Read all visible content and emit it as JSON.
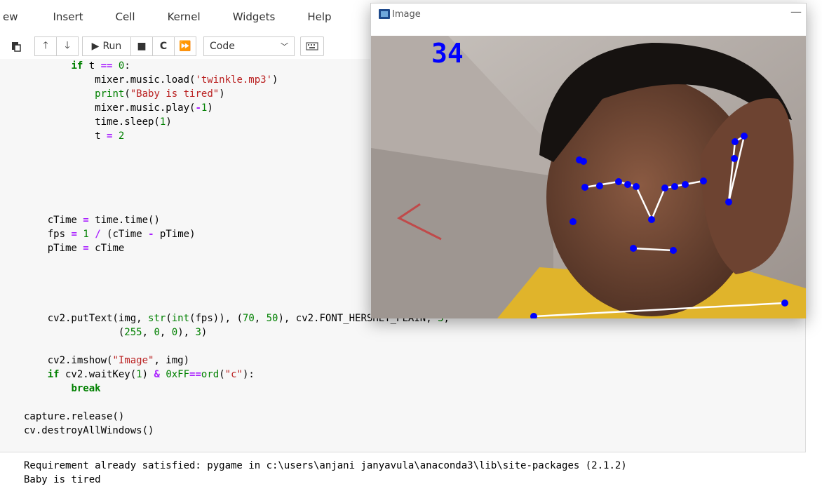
{
  "menu": [
    "ew",
    "Insert",
    "Cell",
    "Kernel",
    "Widgets",
    "Help"
  ],
  "toolbar": {
    "run_label": "Run",
    "cell_type": "Code"
  },
  "code_lines": [
    "        if t == 0:",
    "            mixer.music.load('twinkle.mp3')",
    "            print(\"Baby is tired\")",
    "            mixer.music.play(-1)",
    "            time.sleep(1)",
    "            t = 2",
    "",
    "",
    "",
    "",
    "",
    "    cTime = time.time()",
    "    fps = 1 / (cTime - pTime)",
    "    pTime = cTime",
    "",
    "",
    "",
    "",
    "    cv2.putText(img, str(int(fps)), (70, 50), cv2.FONT_HERSHEY_PLAIN, 3,",
    "                (255, 0, 0), 3)",
    "",
    "    cv2.imshow(\"Image\", img)",
    "    if cv2.waitKey(1) & 0xFF==ord(\"c\"):",
    "        break",
    "",
    "capture.release()",
    "cv.destroyAllWindows()"
  ],
  "output_lines": [
    "Requirement already satisfied: pygame in c:\\users\\anjani janyavula\\anaconda3\\lib\\site-packages (2.1.2)",
    "Baby is tired"
  ],
  "cv_window": {
    "title": "Image",
    "fps_text": "34",
    "minimize_glyph": "—",
    "overlay_color": "#0000ff"
  }
}
